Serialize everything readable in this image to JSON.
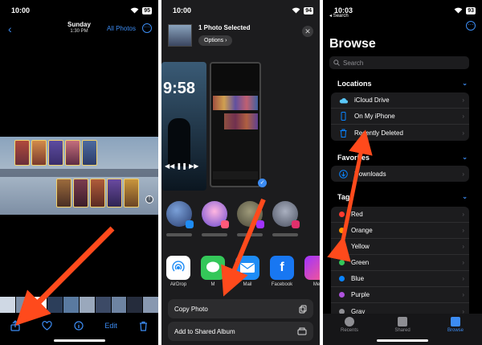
{
  "panel1": {
    "status": {
      "time": "10:00",
      "battery": "95"
    },
    "nav": {
      "day": "Sunday",
      "clock": "1:30 PM",
      "all_photos": "All Photos"
    },
    "toolbar": {
      "edit": "Edit"
    }
  },
  "panel2": {
    "status": {
      "time": "10:00",
      "battery": "94"
    },
    "header": {
      "selected": "1 Photo Selected",
      "options": "Options"
    },
    "preview": {
      "lock_time": "9:58"
    },
    "apps": [
      {
        "label": "AirDrop",
        "icon": "airdrop-icon",
        "color": "#ffffff"
      },
      {
        "label": "M",
        "icon": "messages-icon",
        "color": "#34c759"
      },
      {
        "label": "Mail",
        "icon": "mail-icon",
        "color": "#1e8cf5"
      },
      {
        "label": "Facebook",
        "icon": "facebook-icon",
        "color": "#1877f2"
      },
      {
        "label": "Me",
        "icon": "messenger-icon",
        "color": "#a033ff"
      }
    ],
    "actions": {
      "copy_photo": "Copy Photo",
      "add_shared_album": "Add to Shared Album"
    }
  },
  "panel3": {
    "status": {
      "time": "10:03",
      "battery": "93",
      "back": "Search"
    },
    "title": "Browse",
    "search_placeholder": "Search",
    "locations": {
      "header": "Locations",
      "items": [
        "iCloud Drive",
        "On My iPhone",
        "Recently Deleted"
      ]
    },
    "favorites": {
      "header": "Favorites",
      "items": [
        "Downloads"
      ]
    },
    "tags": {
      "header": "Tags",
      "items": [
        {
          "label": "Red",
          "color": "#ff3b30"
        },
        {
          "label": "Orange",
          "color": "#ff9500"
        },
        {
          "label": "Yellow",
          "color": "#ffcc00"
        },
        {
          "label": "Green",
          "color": "#34c759"
        },
        {
          "label": "Blue",
          "color": "#0a84ff"
        },
        {
          "label": "Purple",
          "color": "#af52de"
        },
        {
          "label": "Gray",
          "color": "#8e8e93"
        }
      ]
    },
    "tabbar": {
      "recents": "Recents",
      "shared": "Shared",
      "browse": "Browse"
    }
  },
  "colors": {
    "accent": "#3c8cf3",
    "annotation_arrow": "#ff4a1c"
  }
}
